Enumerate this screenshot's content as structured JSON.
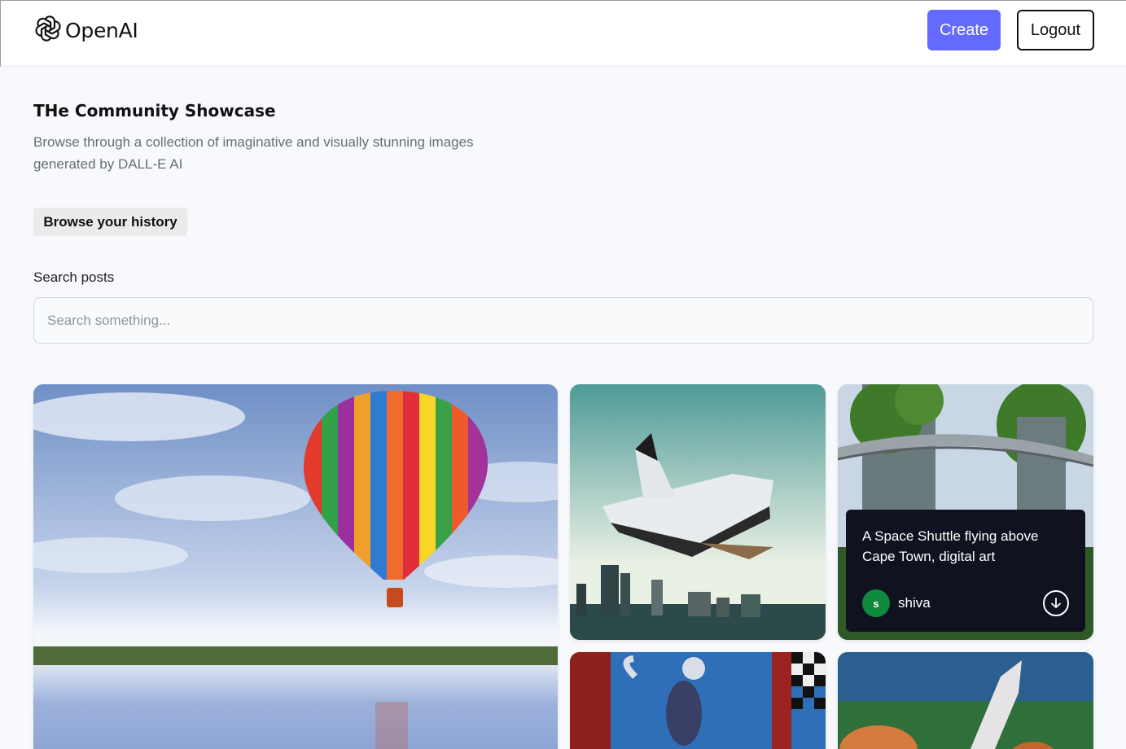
{
  "header": {
    "logo_text": "OpenAI",
    "create_label": "Create",
    "logout_label": "Logout"
  },
  "intro": {
    "title": "THe Community Showcase",
    "subtitle": "Browse through a collection of imaginative and visually stunning images generated by DALL-E AI",
    "history_button": "Browse your history"
  },
  "search": {
    "label": "Search posts",
    "placeholder": "Search something...",
    "value": ""
  },
  "gallery": {
    "cards": [
      {
        "image": "hot-air-balloon-over-lake"
      },
      {
        "image": "space-shuttle-over-city"
      },
      {
        "image": "green-towers-with-bridge",
        "hover": {
          "prompt": "A Space Shuttle flying above Cape Town, digital art",
          "user_initial": "s",
          "user_name": "shiva",
          "action_icon": "download-icon"
        }
      },
      {
        "image": "surreal-lemur-painting"
      },
      {
        "image": "mouse-with-knife"
      }
    ]
  },
  "colors": {
    "accent": "#6469ff",
    "avatar": "#0f8a3c",
    "panel": "#10131f",
    "background": "#f8f9fd"
  }
}
